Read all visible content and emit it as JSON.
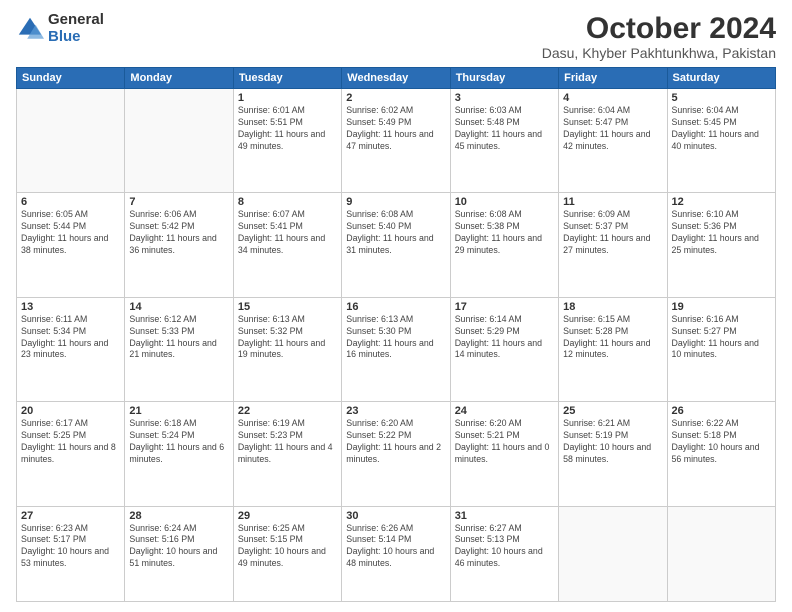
{
  "logo": {
    "general": "General",
    "blue": "Blue"
  },
  "header": {
    "month": "October 2024",
    "location": "Dasu, Khyber Pakhtunkhwa, Pakistan"
  },
  "days_of_week": [
    "Sunday",
    "Monday",
    "Tuesday",
    "Wednesday",
    "Thursday",
    "Friday",
    "Saturday"
  ],
  "weeks": [
    [
      {
        "day": "",
        "info": ""
      },
      {
        "day": "",
        "info": ""
      },
      {
        "day": "1",
        "info": "Sunrise: 6:01 AM\nSunset: 5:51 PM\nDaylight: 11 hours and 49 minutes."
      },
      {
        "day": "2",
        "info": "Sunrise: 6:02 AM\nSunset: 5:49 PM\nDaylight: 11 hours and 47 minutes."
      },
      {
        "day": "3",
        "info": "Sunrise: 6:03 AM\nSunset: 5:48 PM\nDaylight: 11 hours and 45 minutes."
      },
      {
        "day": "4",
        "info": "Sunrise: 6:04 AM\nSunset: 5:47 PM\nDaylight: 11 hours and 42 minutes."
      },
      {
        "day": "5",
        "info": "Sunrise: 6:04 AM\nSunset: 5:45 PM\nDaylight: 11 hours and 40 minutes."
      }
    ],
    [
      {
        "day": "6",
        "info": "Sunrise: 6:05 AM\nSunset: 5:44 PM\nDaylight: 11 hours and 38 minutes."
      },
      {
        "day": "7",
        "info": "Sunrise: 6:06 AM\nSunset: 5:42 PM\nDaylight: 11 hours and 36 minutes."
      },
      {
        "day": "8",
        "info": "Sunrise: 6:07 AM\nSunset: 5:41 PM\nDaylight: 11 hours and 34 minutes."
      },
      {
        "day": "9",
        "info": "Sunrise: 6:08 AM\nSunset: 5:40 PM\nDaylight: 11 hours and 31 minutes."
      },
      {
        "day": "10",
        "info": "Sunrise: 6:08 AM\nSunset: 5:38 PM\nDaylight: 11 hours and 29 minutes."
      },
      {
        "day": "11",
        "info": "Sunrise: 6:09 AM\nSunset: 5:37 PM\nDaylight: 11 hours and 27 minutes."
      },
      {
        "day": "12",
        "info": "Sunrise: 6:10 AM\nSunset: 5:36 PM\nDaylight: 11 hours and 25 minutes."
      }
    ],
    [
      {
        "day": "13",
        "info": "Sunrise: 6:11 AM\nSunset: 5:34 PM\nDaylight: 11 hours and 23 minutes."
      },
      {
        "day": "14",
        "info": "Sunrise: 6:12 AM\nSunset: 5:33 PM\nDaylight: 11 hours and 21 minutes."
      },
      {
        "day": "15",
        "info": "Sunrise: 6:13 AM\nSunset: 5:32 PM\nDaylight: 11 hours and 19 minutes."
      },
      {
        "day": "16",
        "info": "Sunrise: 6:13 AM\nSunset: 5:30 PM\nDaylight: 11 hours and 16 minutes."
      },
      {
        "day": "17",
        "info": "Sunrise: 6:14 AM\nSunset: 5:29 PM\nDaylight: 11 hours and 14 minutes."
      },
      {
        "day": "18",
        "info": "Sunrise: 6:15 AM\nSunset: 5:28 PM\nDaylight: 11 hours and 12 minutes."
      },
      {
        "day": "19",
        "info": "Sunrise: 6:16 AM\nSunset: 5:27 PM\nDaylight: 11 hours and 10 minutes."
      }
    ],
    [
      {
        "day": "20",
        "info": "Sunrise: 6:17 AM\nSunset: 5:25 PM\nDaylight: 11 hours and 8 minutes."
      },
      {
        "day": "21",
        "info": "Sunrise: 6:18 AM\nSunset: 5:24 PM\nDaylight: 11 hours and 6 minutes."
      },
      {
        "day": "22",
        "info": "Sunrise: 6:19 AM\nSunset: 5:23 PM\nDaylight: 11 hours and 4 minutes."
      },
      {
        "day": "23",
        "info": "Sunrise: 6:20 AM\nSunset: 5:22 PM\nDaylight: 11 hours and 2 minutes."
      },
      {
        "day": "24",
        "info": "Sunrise: 6:20 AM\nSunset: 5:21 PM\nDaylight: 11 hours and 0 minutes."
      },
      {
        "day": "25",
        "info": "Sunrise: 6:21 AM\nSunset: 5:19 PM\nDaylight: 10 hours and 58 minutes."
      },
      {
        "day": "26",
        "info": "Sunrise: 6:22 AM\nSunset: 5:18 PM\nDaylight: 10 hours and 56 minutes."
      }
    ],
    [
      {
        "day": "27",
        "info": "Sunrise: 6:23 AM\nSunset: 5:17 PM\nDaylight: 10 hours and 53 minutes."
      },
      {
        "day": "28",
        "info": "Sunrise: 6:24 AM\nSunset: 5:16 PM\nDaylight: 10 hours and 51 minutes."
      },
      {
        "day": "29",
        "info": "Sunrise: 6:25 AM\nSunset: 5:15 PM\nDaylight: 10 hours and 49 minutes."
      },
      {
        "day": "30",
        "info": "Sunrise: 6:26 AM\nSunset: 5:14 PM\nDaylight: 10 hours and 48 minutes."
      },
      {
        "day": "31",
        "info": "Sunrise: 6:27 AM\nSunset: 5:13 PM\nDaylight: 10 hours and 46 minutes."
      },
      {
        "day": "",
        "info": ""
      },
      {
        "day": "",
        "info": ""
      }
    ]
  ]
}
